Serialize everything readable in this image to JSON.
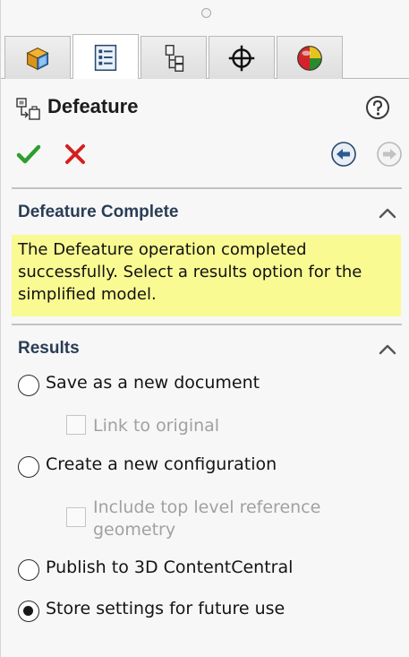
{
  "tabs": [
    {
      "name": "FeatureManager design tree",
      "active": false
    },
    {
      "name": "PropertyManager",
      "active": true
    },
    {
      "name": "ConfigurationManager",
      "active": false
    },
    {
      "name": "DimXpertManager",
      "active": false
    },
    {
      "name": "DisplayManager",
      "active": false
    }
  ],
  "header": {
    "title": "Defeature",
    "icon": "defeature-icon",
    "help_icon": "help-icon"
  },
  "actions": {
    "ok_icon": "checkmark-icon",
    "cancel_icon": "x-icon",
    "back_icon": "back-arrow-icon",
    "forward_icon": "forward-arrow-icon"
  },
  "complete_section": {
    "title": "Defeature Complete",
    "message": "The Defeature operation completed successfully. Select a results option for the simplified model."
  },
  "results_section": {
    "title": "Results",
    "options": [
      {
        "label": "Save as a new document",
        "selected": false
      },
      {
        "label": "Create a new configuration",
        "selected": false
      },
      {
        "label": "Publish to 3D ContentCentral",
        "selected": false
      },
      {
        "label": "Store settings for future use",
        "selected": true
      }
    ],
    "link_to_original": {
      "label": "Link to original",
      "checked": false,
      "enabled": false
    },
    "include_reference": {
      "label": "Include top level reference geometry",
      "checked": false,
      "enabled": false
    }
  },
  "colors": {
    "message_bg": "#fafa92",
    "section_title": "#2a3d55",
    "ok_green": "#2e9e2e",
    "cancel_red": "#d42020"
  }
}
